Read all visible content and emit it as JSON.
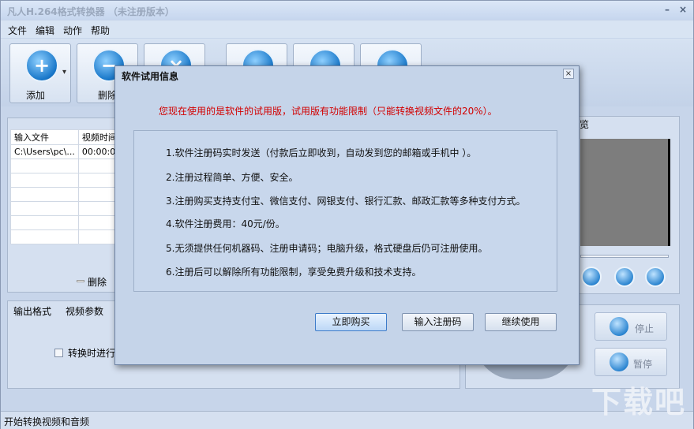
{
  "window": {
    "title": "凡人H.264格式转换器 （未注册版本）",
    "minimize_glyph": "–",
    "close_glyph": "×"
  },
  "menu": [
    "文件",
    "编辑",
    "动作",
    "帮助"
  ],
  "toolbar": {
    "add_label": "添加",
    "delete_label": "删除",
    "dropdown_glyph": "▾"
  },
  "file_list": {
    "headers": [
      "输入文件",
      "视频时间"
    ],
    "rows": [
      [
        "C:\\Users\\pc\\...",
        "00:00:05"
      ]
    ],
    "delete_label": "删除"
  },
  "output_tabs": [
    "输出格式",
    "视频参数"
  ],
  "convert_checkbox_label": "转换时进行",
  "preview_title": "览",
  "side_buttons": {
    "stop_label": "停止",
    "pause_label": "暂停"
  },
  "status": "开始转换视频和音频",
  "watermark": "下载吧",
  "dialog": {
    "title": "软件试用信息",
    "close_glyph": "×",
    "warning": "您现在使用的是软件的试用版，试用版有功能限制（只能转换视频文件的20%）。",
    "lines": [
      "1.软件注册码实时发送（付款后立即收到，自动发到您的邮箱或手机中 ）。",
      "2.注册过程简单、方便、安全。",
      "3.注册购买支持支付宝、微信支付、网银支付、银行汇款、邮政汇款等多种支付方式。",
      "4.软件注册费用：40元/份。",
      "5.无须提供任何机器码、注册申请码；电脑升级，格式硬盘后仍可注册使用。",
      "6.注册后可以解除所有功能限制，享受免费升级和技术支持。"
    ],
    "buy_button": "立即购买",
    "register_button": "输入注册码",
    "continue_button": "继续使用"
  }
}
